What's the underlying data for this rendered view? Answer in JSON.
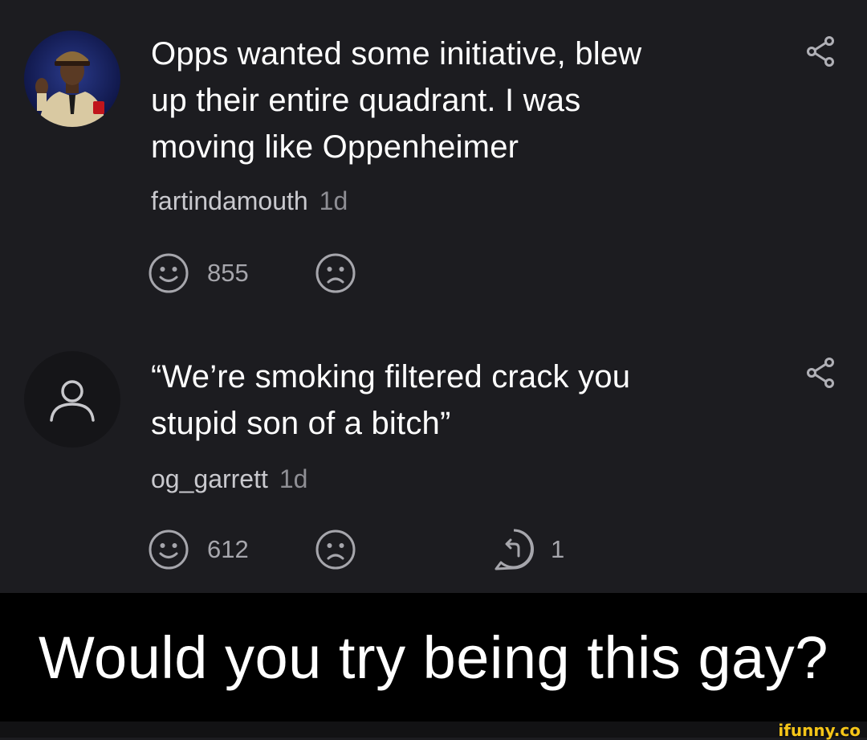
{
  "comments": [
    {
      "text_lines": [
        "Opps wanted some initiative, blew",
        "up their entire quadrant. I was",
        "moving like Oppenheimer"
      ],
      "username": "fartindamouth",
      "age": "1d",
      "upvotes": "855",
      "avatar": "photo-avatar"
    },
    {
      "text_lines": [
        "“We’re smoking filtered crack you",
        "stupid son of a bitch”"
      ],
      "username": "og_garrett",
      "age": "1d",
      "upvotes": "612",
      "replies": "1",
      "avatar": "default-user-icon"
    }
  ],
  "caption": "Would you try being this gay?",
  "watermark": "ifunny.co",
  "colors": {
    "background": "#1c1c20",
    "caption_bg": "#000000",
    "watermark": "#f5c518"
  }
}
